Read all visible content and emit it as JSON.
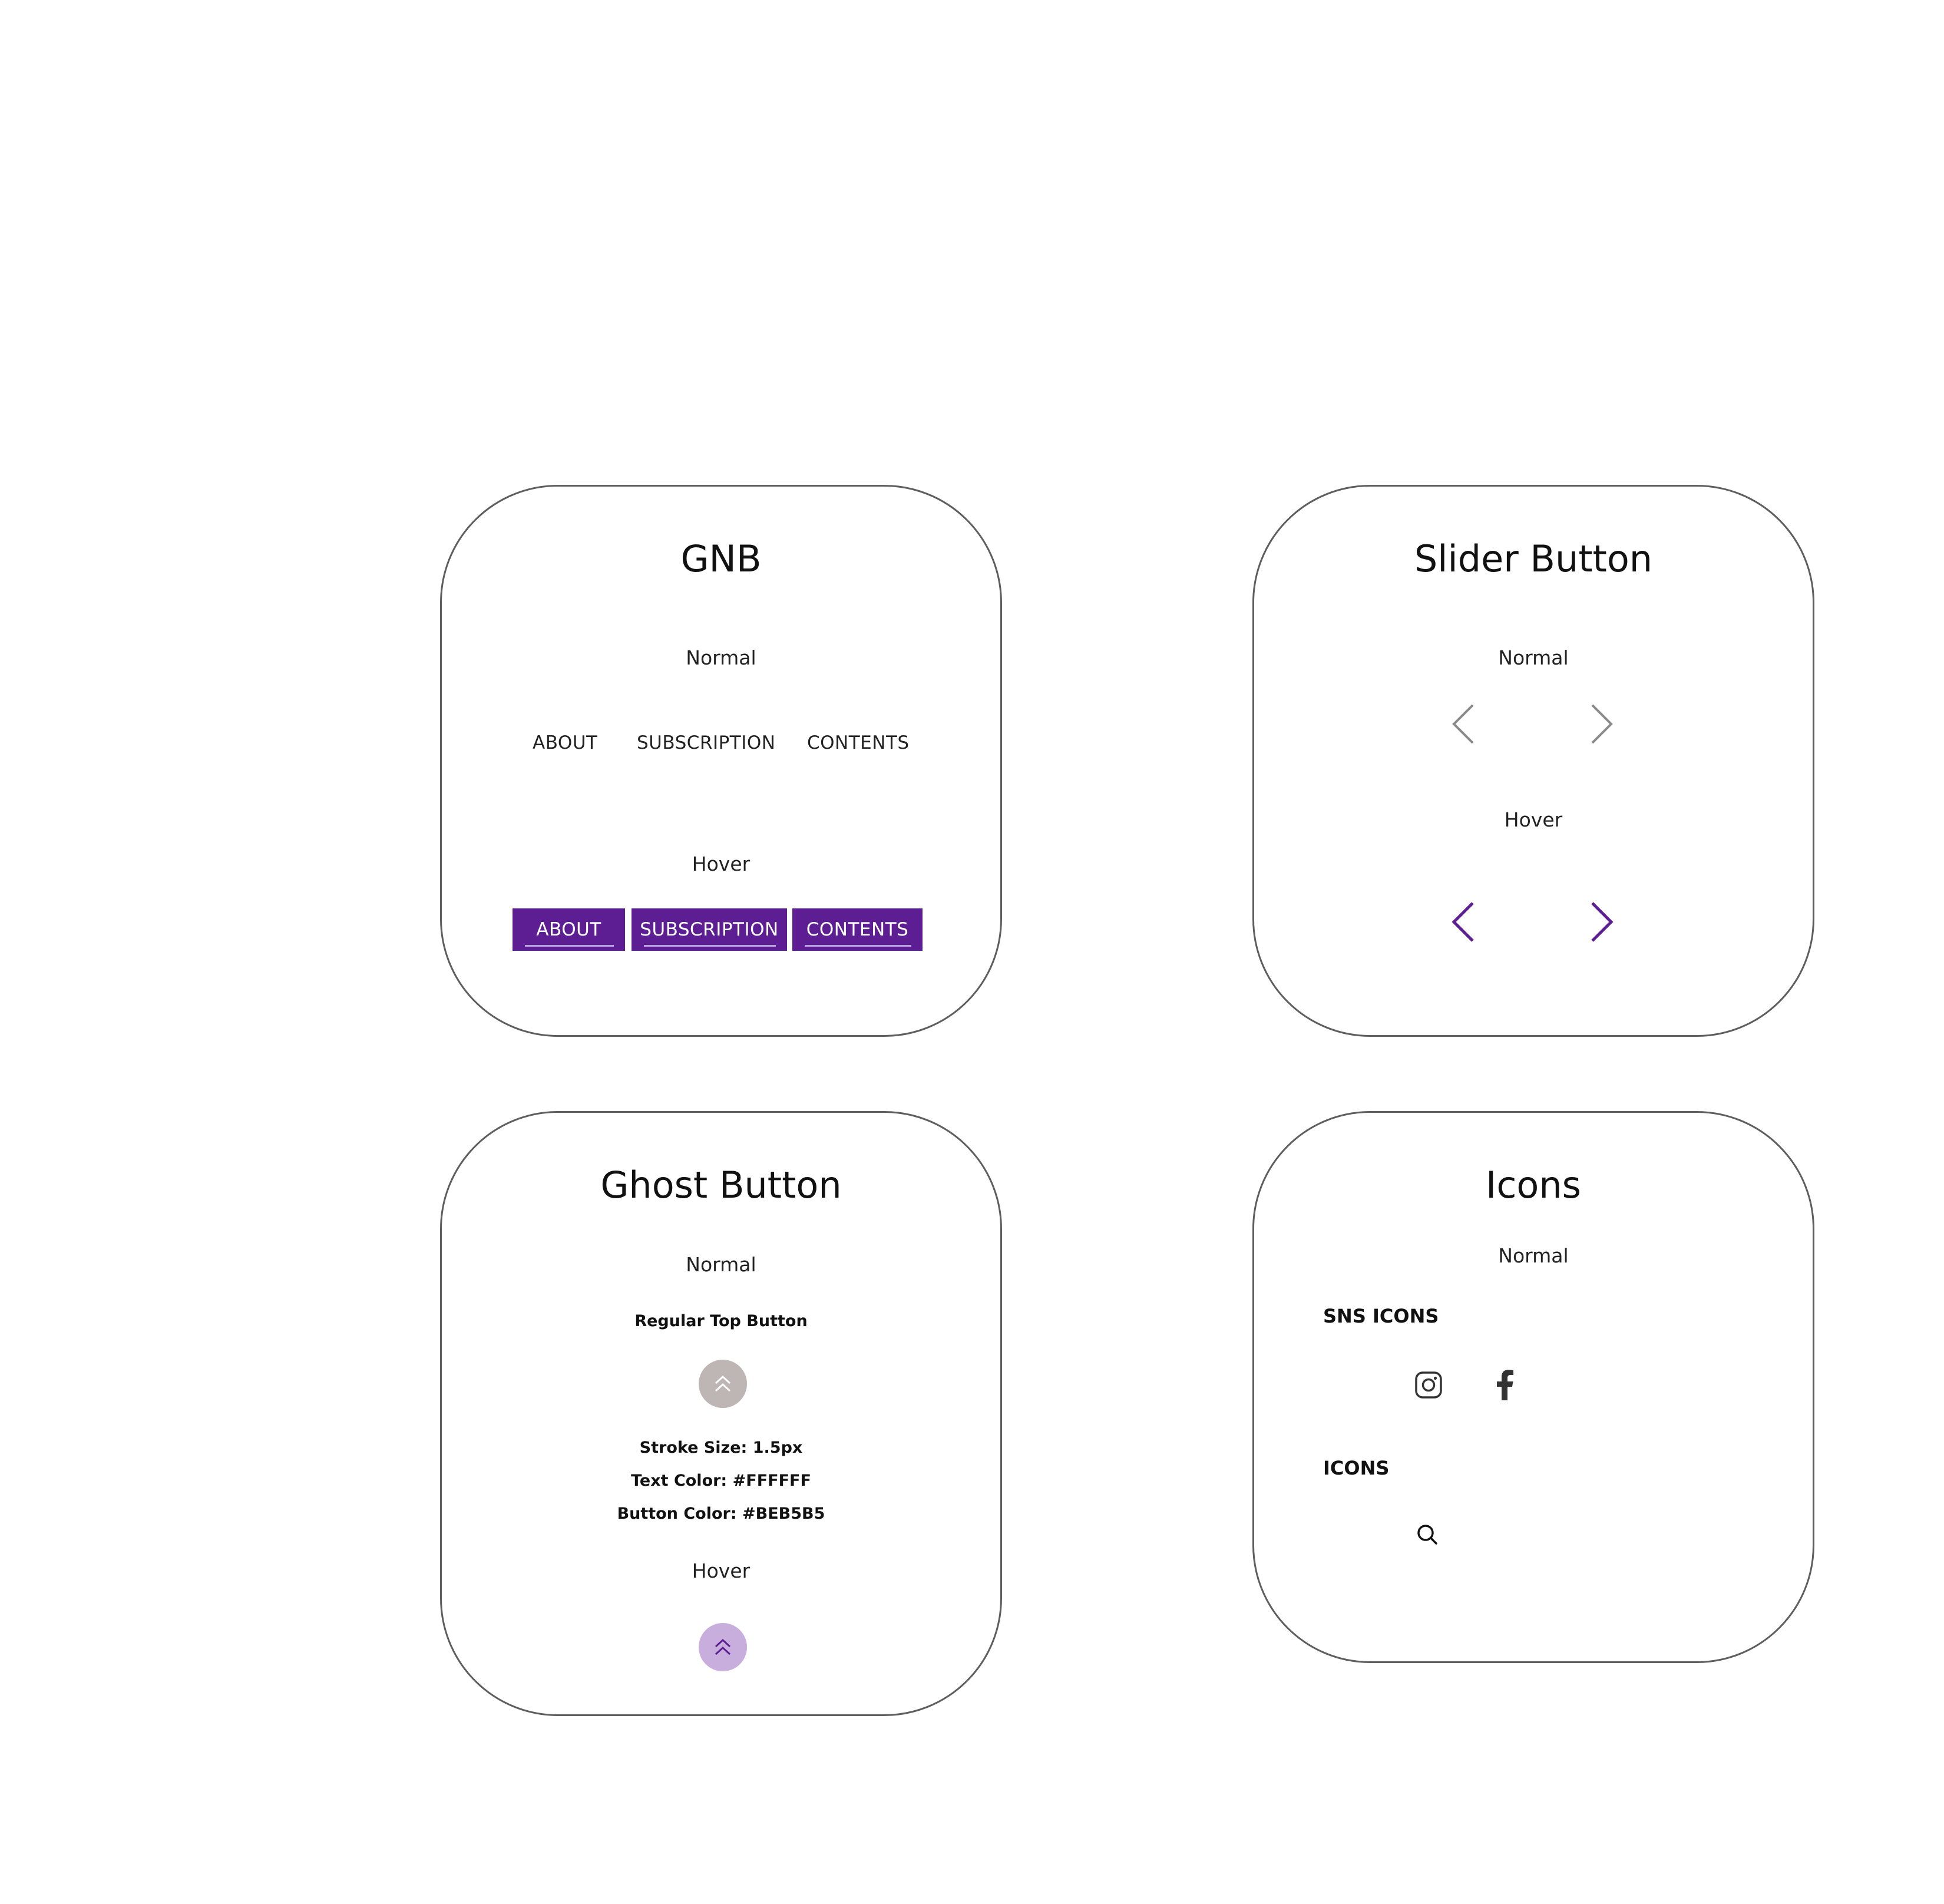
{
  "gnb": {
    "title": "GNB",
    "normal_label": "Normal",
    "hover_label": "Hover",
    "items": [
      "ABOUT",
      "SUBSCRIPTION",
      "CONTENTS"
    ],
    "hover_color": "#5C1E92"
  },
  "slider": {
    "title": "Slider Button",
    "normal_label": "Normal",
    "hover_label": "Hover",
    "prev_icon": "chevron-left-icon",
    "next_icon": "chevron-right-icon",
    "normal_color": "#8A8A8A",
    "hover_color": "#5C1E92"
  },
  "ghost": {
    "title": "Ghost Button",
    "normal_label": "Normal",
    "subtitle": "Regular Top Button",
    "specs": [
      "Stroke Size: 1.5px",
      "Text Color: #FFFFFF",
      "Button Color: #BEB5B5"
    ],
    "hover_label": "Hover",
    "icon": "double-chevron-up-icon",
    "normal_color": "#BEB5B5",
    "hover_color": "#C7AEDD"
  },
  "icons": {
    "title": "Icons",
    "normal_label": "Normal",
    "sns_label": "SNS ICONS",
    "icons_label": "ICONS",
    "sns_icons": [
      "instagram-icon",
      "facebook-icon"
    ],
    "other_icons": [
      "search-icon"
    ]
  }
}
